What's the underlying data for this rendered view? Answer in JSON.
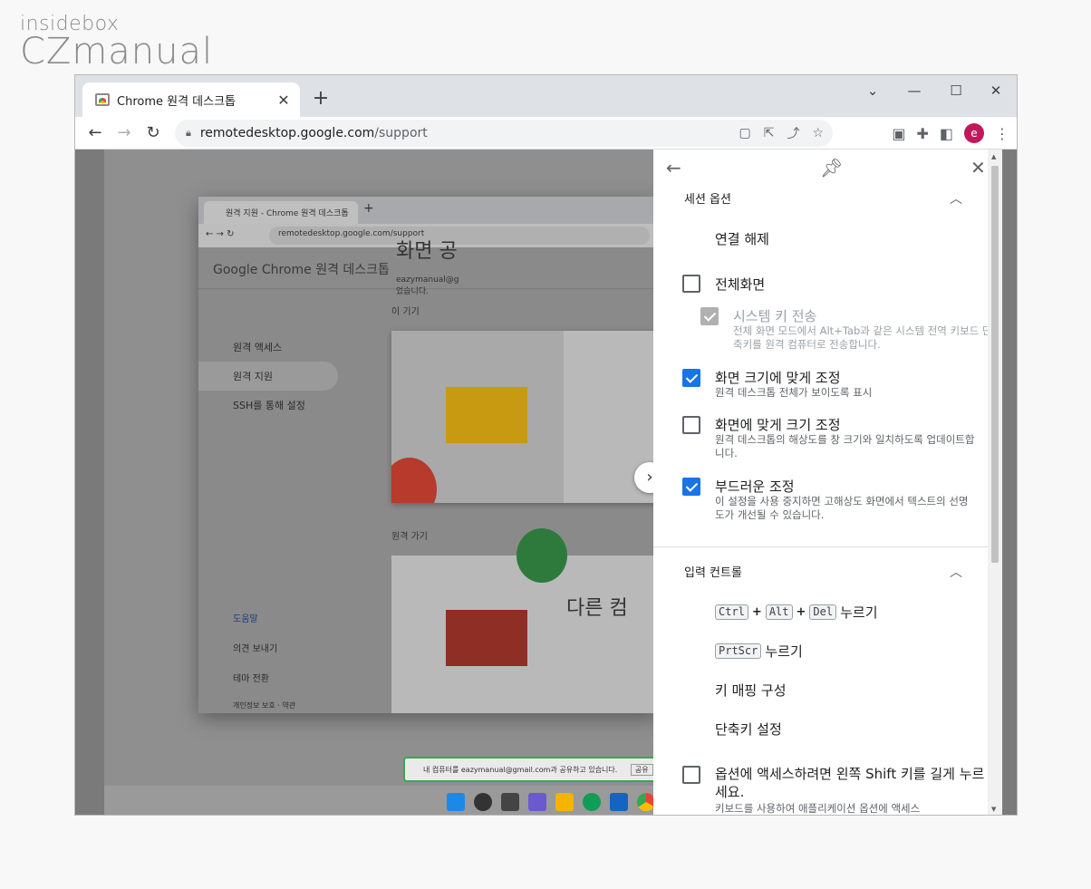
{
  "logo": {
    "top": "insidebox",
    "main": "CZmanual"
  },
  "browser": {
    "tab_title": "Chrome 원격 데스크톱",
    "tab_close": "✕",
    "new_tab": "+",
    "url_host": "remotedesktop.google.com",
    "url_path": "/support",
    "avatar_letter": "e",
    "window_controls": {
      "dropdown": "⌄",
      "minimize": "—",
      "maximize": "☐",
      "close": "✕"
    }
  },
  "remote": {
    "tab_title": "원격 지원 - Chrome 원격 데스크톱",
    "url": "remotedesktop.google.com/support",
    "header_brand": "Google Chrome",
    "header_title": "원격 데스크톱",
    "section_this_device": "이 기기",
    "section_remote": "원격 가기",
    "nav": [
      "원격 액세스",
      "원격 지원",
      "SSH를 통해 설정"
    ],
    "card1_title": "화면 공",
    "card1_sub": "eazymanual@g\n었습니다.",
    "card2_title": "다른 컴",
    "help": "도움말",
    "feedback": "의견 보내기",
    "theme": "테마 전환",
    "privacy": "개인정보 보호 · 약관",
    "share_bar": "내 컴퓨터를 eazymanual@gmail.com과 공유하고 있습니다.",
    "share_btn": "공유"
  },
  "panel": {
    "session_title": "세션 옵션",
    "disconnect": "연결 해제",
    "fullscreen": "전체화면",
    "system_keys": "시스템 키 전송",
    "system_keys_desc": "전체 화면 모드에서 Alt+Tab과 같은 시스템 전역 키보드 단축키를 원격 컴퓨터로 전송합니다.",
    "fit_screen": "화면 크기에 맞게 조정",
    "fit_screen_desc": "원격 데스크톱 전체가 보이도록 표시",
    "resize": "화면에 맞게 크기 조정",
    "resize_desc": "원격 데스크톱의 해상도를 창 크기와 일치하도록 업데이트합니다.",
    "smooth": "부드러운 조정",
    "smooth_desc": "이 설정을 사용 중지하면 고해상도 화면에서 텍스트의 선명도가 개선될 수 있습니다.",
    "input_title": "입력 컨트롤",
    "ctrl": "Ctrl",
    "alt": "Alt",
    "del": "Del",
    "press": "누르기",
    "prtscr": "PrtScr",
    "key_mapping": "키 매핑 구성",
    "shortcut": "단축키 설정",
    "shift_option": "옵션에 액세스하려면 왼쪽 Shift 키를 길게 누르세요.",
    "shift_desc": "키보드를 사용하여 애플리케이션 옵션에 액세스"
  },
  "states": {
    "fullscreen": false,
    "system_keys": true,
    "fit_screen": true,
    "resize": false,
    "smooth": true,
    "shift_option": false
  }
}
